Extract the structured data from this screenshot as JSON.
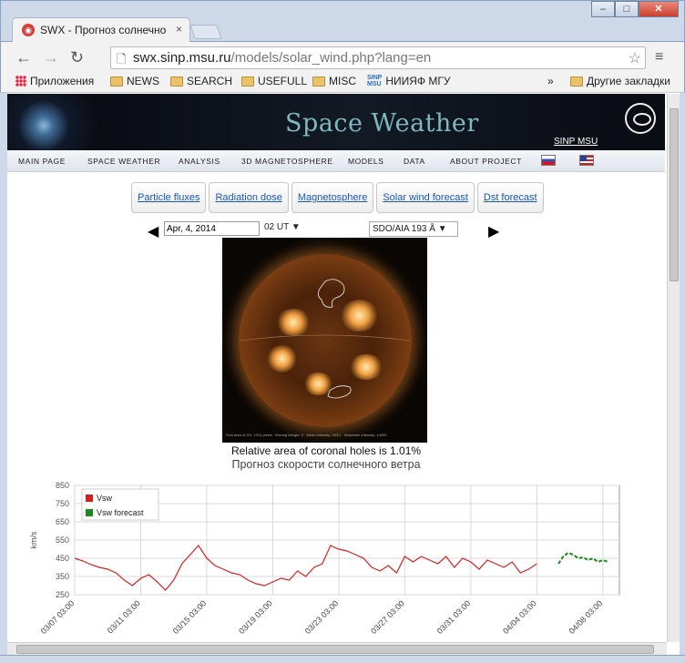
{
  "browser": {
    "tab_title": "SWX - Прогноз солнечно",
    "tab_close": "×",
    "url_host": "swx.sinp.msu.ru",
    "url_path": "/models/solar_wind.php?lang=en",
    "window_min": "–",
    "window_max": "□",
    "window_close": "✕",
    "back_icon": "←",
    "forward_icon": "→",
    "reload_icon": "↻",
    "star_icon": "☆",
    "menu_icon": "≡",
    "page_icon": "🗋"
  },
  "bookmarks": {
    "apps": "Приложения",
    "items": [
      "NEWS",
      "SEARCH",
      "USEFULL",
      "MISC"
    ],
    "sinp_label": "НИИЯФ МГУ",
    "sinp_logo_top": "SINP",
    "sinp_logo_bottom": "MSU",
    "more": "»",
    "other": "Другие закладки"
  },
  "site": {
    "title": "Space Weather",
    "sinp_msu": "SINP MSU",
    "nav": [
      "MAIN PAGE",
      "SPACE WEATHER",
      "ANALYSIS",
      "3D MAGNETOSPHERE",
      "MODELS",
      "DATA",
      "ABOUT PROJECT"
    ]
  },
  "tabs": [
    "Particle fluxes",
    "Radiation dose",
    "Magnetosphere",
    "Solar wind forecast",
    "Dst forecast"
  ],
  "controls": {
    "date": "Apr, 4, 2014",
    "hour": "02 UT",
    "instrument": "SDO/AIA 193 Å",
    "prev_icon": "◀",
    "next_icon": "▶",
    "dropdown_icon": "▼"
  },
  "image": {
    "caption": "First area of CH: 1314 pixels · Moving integer: 0 · Mean intensity: 903.2 · Maximum intensity: 14000"
  },
  "text": {
    "relative_area": "Relative area of coronal holes is 1.01%",
    "forecast_title": "Прогноз скорости солнечного ветра"
  },
  "chart_data": {
    "type": "line",
    "ylabel": "km/s",
    "ylim": [
      250,
      850
    ],
    "yticks": [
      250,
      350,
      450,
      550,
      650,
      750,
      850
    ],
    "xticks": [
      "03/07 03:00",
      "03/11 03:00",
      "03/15 03:00",
      "03/19 03:00",
      "03/23 03:00",
      "03/27 03:00",
      "03/31 03:00",
      "04/04 03:00",
      "04/08 03:00"
    ],
    "xlim_days": [
      0,
      33
    ],
    "legend_position": "top-left",
    "grid": true,
    "series": [
      {
        "name": "Vsw",
        "color": "#d62020",
        "x": [
          0,
          0.5,
          1,
          1.5,
          2,
          2.5,
          3,
          3.5,
          4,
          4.5,
          5,
          5.5,
          6,
          6.5,
          7,
          7.5,
          8,
          8.5,
          9,
          9.5,
          10,
          10.5,
          11,
          11.5,
          12,
          12.5,
          13,
          13.5,
          14,
          14.5,
          15,
          15.5,
          16,
          16.5,
          17,
          17.5,
          18,
          18.5,
          19,
          19.5,
          20,
          20.5,
          21,
          21.5,
          22,
          22.5,
          23,
          23.5,
          24,
          24.5,
          25,
          25.5,
          26,
          26.5,
          27,
          27.5,
          28
        ],
        "y": [
          450,
          435,
          415,
          400,
          390,
          370,
          330,
          300,
          340,
          360,
          320,
          275,
          330,
          420,
          470,
          520,
          450,
          410,
          390,
          370,
          360,
          330,
          310,
          300,
          320,
          340,
          330,
          380,
          350,
          400,
          420,
          520,
          500,
          490,
          470,
          450,
          400,
          380,
          410,
          370,
          460,
          430,
          460,
          440,
          420,
          460,
          400,
          450,
          430,
          390,
          440,
          420,
          400,
          430,
          370,
          390,
          420
        ]
      },
      {
        "name": "Vsw forecast",
        "color": "#1a8a1a",
        "x": [
          29.3,
          29.6,
          29.9,
          30.2,
          30.5,
          30.8,
          31.1,
          31.4,
          31.7,
          32,
          32.3
        ],
        "y": [
          420,
          460,
          480,
          470,
          450,
          455,
          440,
          450,
          430,
          440,
          430
        ]
      }
    ]
  }
}
